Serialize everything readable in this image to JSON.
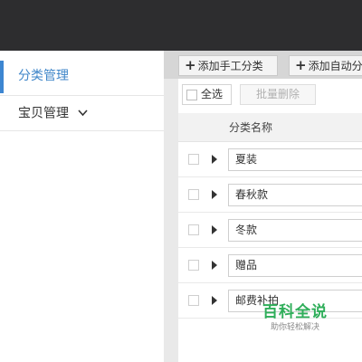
{
  "sidebar": {
    "items": [
      {
        "label": "分类管理",
        "active": true
      },
      {
        "label": "宝贝管理",
        "icon": "chevron-down-icon"
      }
    ]
  },
  "tabs": {
    "add_manual": "添加手工分类",
    "add_auto": "添加自动分类",
    "plus_icon": "plus-icon"
  },
  "toolbar": {
    "select_all": "全选",
    "batch_delete": "批量删除"
  },
  "table": {
    "header_name": "分类名称",
    "rows": [
      {
        "name": "夏装"
      },
      {
        "name": "春秋款"
      },
      {
        "name": "冬款"
      },
      {
        "name": "赠品"
      },
      {
        "name": "邮费补拍"
      }
    ]
  },
  "watermark": {
    "title": "百科全说",
    "subtitle": "助你轻松解决"
  },
  "colors": {
    "topbar": "#2d2d2f",
    "accent": "#3d86d1",
    "watermark": "#2fae5a"
  }
}
